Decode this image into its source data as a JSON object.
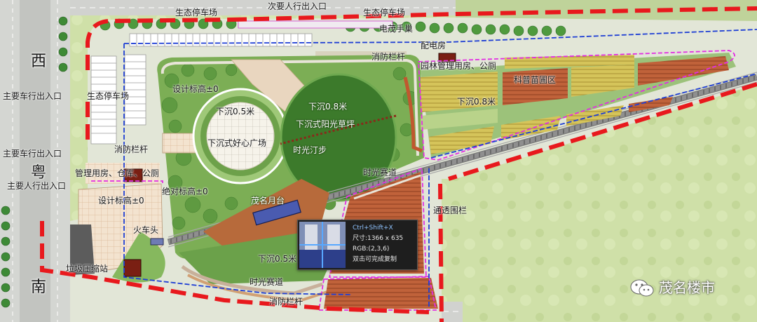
{
  "labels": {
    "eco_parking_top_left": "生态停车场",
    "secondary_ped_entrance": "次要人行出入口",
    "eco_parking_top_right": "生态停车场",
    "maomao_street": "电茂手巢",
    "power_room": "配电房",
    "firefighting_rail_top": "消防栏杆",
    "garden_mgmt": "园林管理用房、公厕",
    "nursery": "科普苗圃区",
    "main_vehicle_entrance_1": "主要车行出入口",
    "eco_parking_left": "生态停车场",
    "design_elevation_top": "设计标高±0",
    "sunken_05_circle": "下沉0.5米",
    "sunken_08_lawn": "下沉0.8米",
    "sunken_lawn": "下沉式阳光草坪",
    "sunken_plaza": "下沉式好心广场",
    "sunken_08_right": "下沉0.8米",
    "time_walk": "时光汀步",
    "main_vehicle_entrance_2": "主要车行出入口",
    "firefighting_rail_left": "消防栏杆",
    "mgmt_storage": "管理用房、仓库、公厕",
    "main_ped_entrance": "主要人行出入口",
    "time_track_mid": "时光赛道",
    "absolute_elevation": "绝对标高±0",
    "maoming_platform": "茂名月台",
    "design_elevation_left": "设计标高±0",
    "transparent_fence": "通透围栏",
    "train_head": "火车头",
    "sunken_05_bottom": "下沉0.5米",
    "garbage_station": "垃圾压缩站",
    "time_track_bottom": "时光赛道",
    "firefighting_rail_bottom": "消防栏杆",
    "road_west_1": "西",
    "road_west_2": "粤",
    "road_west_3": "南"
  },
  "tooltip": {
    "shortcut": "Ctrl+Shift+X",
    "size": "尺寸:1366 x 635",
    "rgb": "RGB:(2,3,6)",
    "hint": "双击可完成复制"
  },
  "watermark": {
    "text": "茂名楼市",
    "icon": "wechat-icon"
  },
  "colors": {
    "redline": "#e8191d",
    "magenta": "#e22fe2",
    "blue": "#1f3fd4",
    "lawn": "#3f7a2a",
    "field_yellow": "#c8b94a",
    "field_brown": "#b85a2e"
  }
}
